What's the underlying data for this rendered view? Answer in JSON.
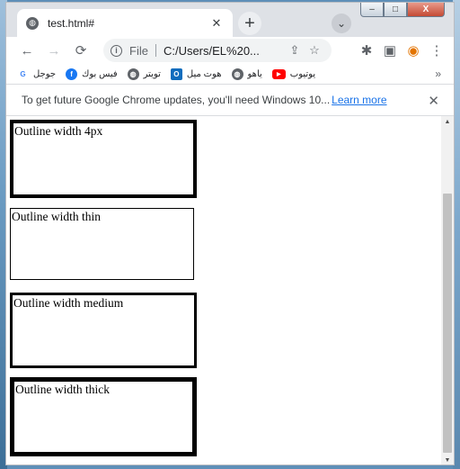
{
  "window": {
    "minimize": "–",
    "maximize": "□",
    "close": "X"
  },
  "tab": {
    "title": "test.html#",
    "close": "✕",
    "new_tab": "+",
    "tab_search": "⌄"
  },
  "toolbar": {
    "back": "←",
    "forward": "→",
    "reload": "⟳",
    "info": "i",
    "file_label": "File",
    "url": "C:/Users/EL%20...",
    "share": "⇪",
    "bookmark_star": "☆",
    "extensions": "✱",
    "side_panel": "▣",
    "profile": "◉",
    "menu": "⋮"
  },
  "bookmarks": {
    "items": [
      {
        "label": "جوجل",
        "icon": "google-icon",
        "color": "#4285f4",
        "glyph": "G"
      },
      {
        "label": "فيس بوك",
        "icon": "facebook-icon",
        "color": "#1877f2",
        "glyph": "f"
      },
      {
        "label": "تويتر",
        "icon": "globe-icon",
        "color": "#5f6368",
        "glyph": "◍"
      },
      {
        "label": "هوت ميل",
        "icon": "outlook-icon",
        "color": "#0f6cbd",
        "glyph": "O"
      },
      {
        "label": "ياهو",
        "icon": "globe-icon",
        "color": "#5f6368",
        "glyph": "◍"
      },
      {
        "label": "يوتيوب",
        "icon": "youtube-icon",
        "color": "#ff0000",
        "glyph": "▶"
      }
    ],
    "more": "»"
  },
  "infobar": {
    "text": "To get future Google Chrome updates, you'll need Windows 10...",
    "link": "Learn more",
    "close": "✕"
  },
  "content": {
    "boxes": [
      {
        "label": "Outline width 4px"
      },
      {
        "label": "Outline width thin"
      },
      {
        "label": "Outline width medium"
      },
      {
        "label": "Outline width thick"
      }
    ]
  },
  "scrollbar": {
    "up": "▲",
    "down": "▼"
  }
}
